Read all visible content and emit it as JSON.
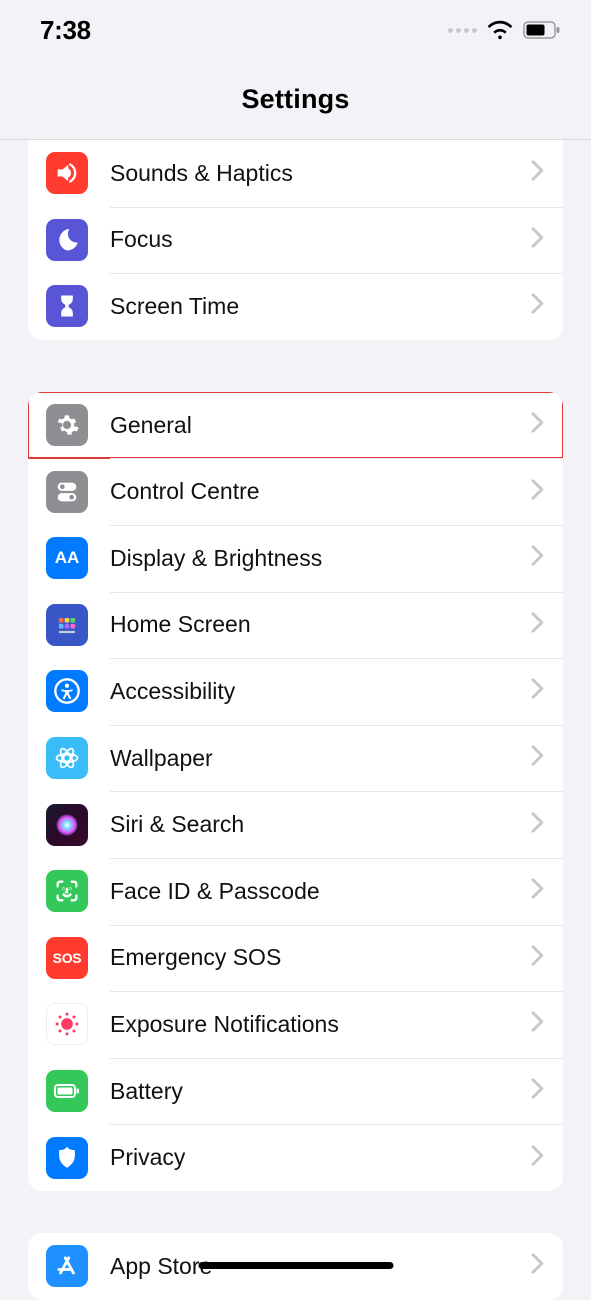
{
  "status": {
    "time": "7:38"
  },
  "header": {
    "title": "Settings"
  },
  "group1": {
    "items": [
      {
        "label": "Sounds & Haptics"
      },
      {
        "label": "Focus"
      },
      {
        "label": "Screen Time"
      }
    ]
  },
  "group2": {
    "items": [
      {
        "label": "General"
      },
      {
        "label": "Control Centre"
      },
      {
        "label": "Display & Brightness"
      },
      {
        "label": "Home Screen"
      },
      {
        "label": "Accessibility"
      },
      {
        "label": "Wallpaper"
      },
      {
        "label": "Siri & Search"
      },
      {
        "label": "Face ID & Passcode"
      },
      {
        "label": "Emergency SOS"
      },
      {
        "label": "Exposure Notifications"
      },
      {
        "label": "Battery"
      },
      {
        "label": "Privacy"
      }
    ]
  },
  "group3": {
    "items": [
      {
        "label": "App Store"
      }
    ]
  },
  "highlight_row": "general",
  "colors": {
    "highlight": "#e03a3a"
  },
  "sos_text": "SOS",
  "aa_text": "AA"
}
